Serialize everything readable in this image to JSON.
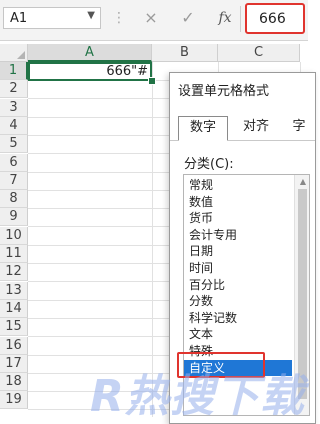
{
  "formula_bar": {
    "name_box": "A1",
    "cancel_icon": "×",
    "enter_icon": "✓",
    "function_icon": "fx",
    "value": "666"
  },
  "sheet": {
    "columns": [
      "A",
      "B",
      "C"
    ],
    "rows": [
      "1",
      "2",
      "3",
      "4",
      "5",
      "6",
      "7",
      "8",
      "9",
      "10",
      "11",
      "12",
      "13",
      "14",
      "15",
      "16",
      "17",
      "18",
      "19"
    ],
    "active_cell_value": "666\"#"
  },
  "dialog": {
    "title": "设置单元格格式",
    "tabs": [
      "数字",
      "对齐",
      "字"
    ],
    "category_label": "分类(C):",
    "categories": [
      "常规",
      "数值",
      "货币",
      "会计专用",
      "日期",
      "时间",
      "百分比",
      "分数",
      "科学记数",
      "文本",
      "特殊",
      "自定义"
    ],
    "selected_category": "自定义"
  },
  "watermark": "R热搜下载",
  "colors": {
    "excel_green": "#217346",
    "highlight_red": "#e0342e",
    "selection_blue": "#1f77d6"
  }
}
